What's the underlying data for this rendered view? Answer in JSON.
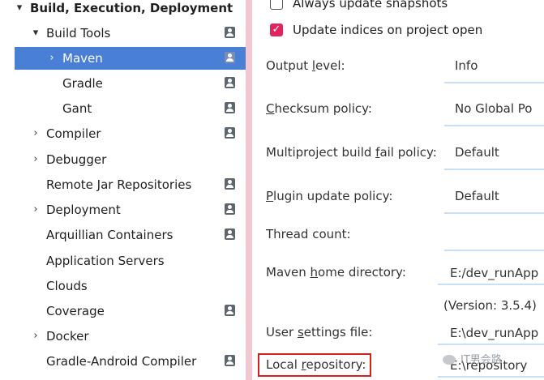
{
  "sidebar": {
    "items": [
      {
        "label": "Build, Execution, Deployment",
        "chevron": "▾",
        "project_icon": false
      },
      {
        "label": "Build Tools",
        "chevron": "▾",
        "project_icon": true
      },
      {
        "label": "Maven",
        "chevron": "›",
        "project_icon": true,
        "selected": true
      },
      {
        "label": "Gradle",
        "chevron": "",
        "project_icon": true
      },
      {
        "label": "Gant",
        "chevron": "",
        "project_icon": true
      },
      {
        "label": "Compiler",
        "chevron": "›",
        "project_icon": true
      },
      {
        "label": "Debugger",
        "chevron": "›",
        "project_icon": false
      },
      {
        "label": "Remote Jar Repositories",
        "chevron": "",
        "project_icon": true
      },
      {
        "label": "Deployment",
        "chevron": "›",
        "project_icon": true
      },
      {
        "label": "Arquillian Containers",
        "chevron": "",
        "project_icon": true
      },
      {
        "label": "Application Servers",
        "chevron": "",
        "project_icon": false
      },
      {
        "label": "Clouds",
        "chevron": "",
        "project_icon": false
      },
      {
        "label": "Coverage",
        "chevron": "",
        "project_icon": true
      },
      {
        "label": "Docker",
        "chevron": "›",
        "project_icon": false
      },
      {
        "label": "Gradle-Android Compiler",
        "chevron": "",
        "project_icon": true
      }
    ]
  },
  "settings": {
    "always_update_snapshots": {
      "label": "Always update snapshots",
      "checked": false
    },
    "update_indices": {
      "label": "Update indices on project open",
      "checked": true
    },
    "output_level": {
      "label_pre": "Output ",
      "label_mn": "l",
      "label_post": "evel:",
      "value": "Info"
    },
    "checksum_policy": {
      "label_pre": "",
      "label_mn": "C",
      "label_post": "hecksum policy:",
      "value": "No Global Po"
    },
    "multiproject_fail": {
      "label_pre": "Multiproject build ",
      "label_mn": "f",
      "label_post": "ail policy:",
      "value": "Default"
    },
    "plugin_update": {
      "label_pre": "",
      "label_mn": "P",
      "label_post": "lugin update policy:",
      "value": "Default"
    },
    "thread_count": {
      "label": "Thread count:"
    },
    "maven_home": {
      "label_pre": "Maven ",
      "label_mn": "h",
      "label_post": "ome directory:",
      "value": "E:/dev_runApp"
    },
    "version": "(Version: 3.5.4)",
    "user_settings": {
      "label_pre": "User ",
      "label_mn": "s",
      "label_post": "ettings file:",
      "value": "E:\\dev_runApp"
    },
    "local_repo": {
      "label_pre": "Local ",
      "label_mn": "r",
      "label_post": "epository:",
      "value": "E:\\repository"
    }
  },
  "watermark": {
    "text": "IT男会路"
  },
  "colors": {
    "selection": "#4a7fd6",
    "divider": "#f1c7d2",
    "highlight": "#d62020",
    "checkbox_on": "#e0245e"
  }
}
